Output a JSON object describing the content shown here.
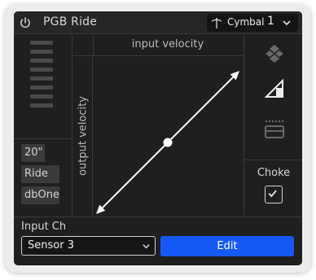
{
  "header": {
    "title": "PGB Ride",
    "power_icon": "power-icon",
    "cymbal_select": {
      "icon": "cymbal-icon",
      "label": "Cymbal",
      "number": "1",
      "chevron_icon": "chevron-down-icon"
    }
  },
  "left_panel": {
    "level_meter_segments": 8,
    "info": [
      "20\"",
      "Ride",
      "dbOne"
    ]
  },
  "graph": {
    "x_label": "input velocity",
    "y_label": "output velocity",
    "curve": {
      "type": "linear",
      "start": [
        0,
        0
      ],
      "end": [
        1,
        1
      ],
      "midpoint_handle": [
        0.5,
        0.5
      ]
    }
  },
  "right_panel": {
    "tools": [
      "layers-icon",
      "velocity-ramp-icon",
      "tray-icon"
    ],
    "choke_label": "Choke",
    "choke_checked": true
  },
  "bottom": {
    "input_ch_label": "Input Ch",
    "sensor_value": "Sensor 3",
    "edit_label": "Edit"
  },
  "colors": {
    "panel_bg": "#1f1f1f",
    "accent_blue": "#1559f5",
    "line_color": "#ffffff"
  }
}
